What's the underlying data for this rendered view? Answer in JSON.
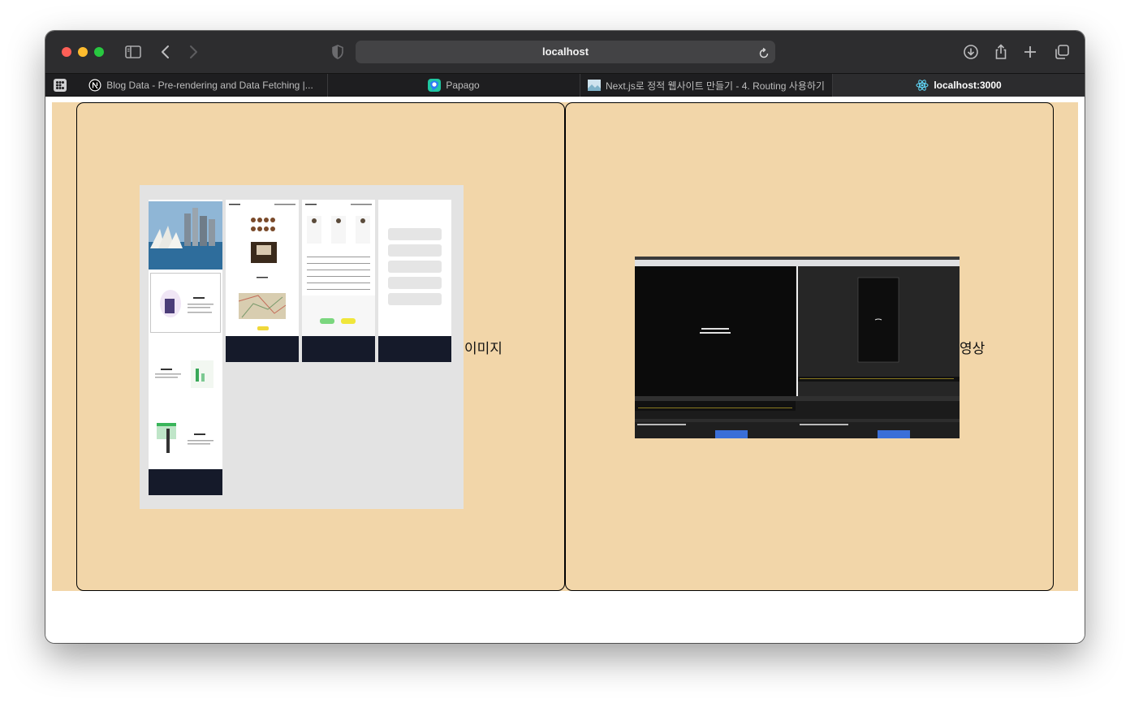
{
  "browser": {
    "url_display": "localhost",
    "tabs": [
      {
        "title": "Blog Data - Pre-rendering and Data Fetching |...",
        "favicon": "nextjs-icon",
        "active": false
      },
      {
        "title": "Papago",
        "favicon": "papago-icon",
        "active": false
      },
      {
        "title": "Next.js로 정적 웹사이트 만들기 - 4. Routing 사용하기",
        "favicon": "thumbnail-icon",
        "active": false
      },
      {
        "title": "localhost:3000",
        "favicon": "react-icon",
        "active": true
      }
    ]
  },
  "page": {
    "background_color": "#f2d6a9",
    "cards": [
      {
        "label": "이미지",
        "media": "image"
      },
      {
        "label": "영상",
        "media": "video"
      }
    ]
  }
}
